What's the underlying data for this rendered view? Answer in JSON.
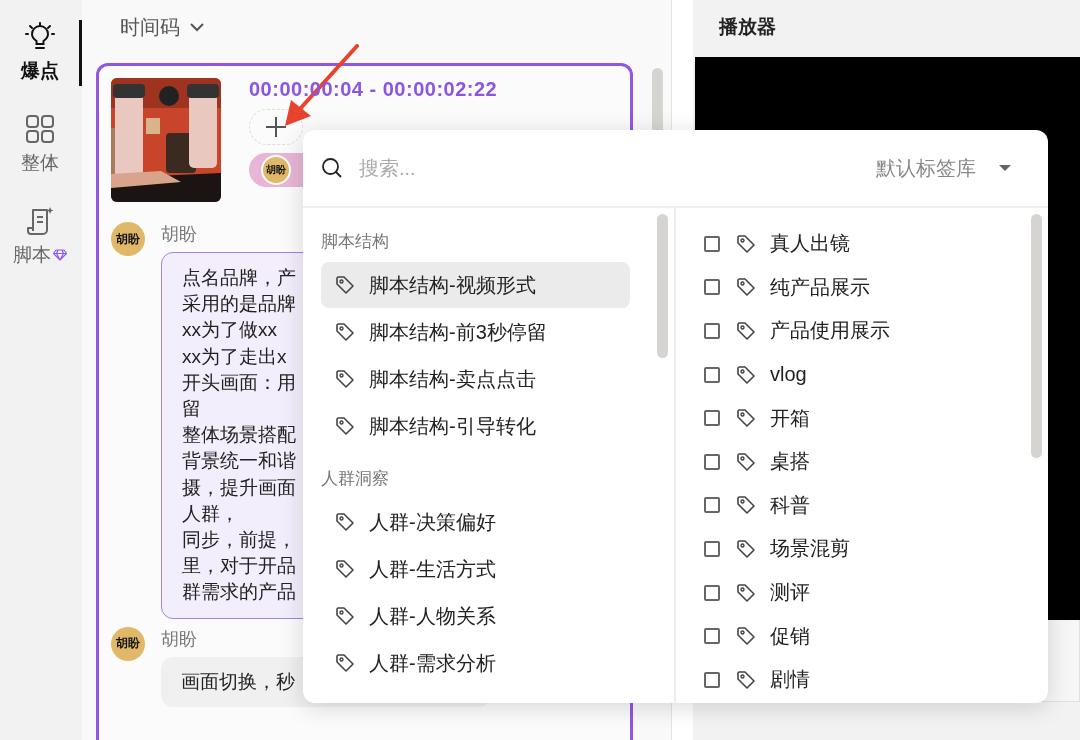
{
  "sidebar": {
    "items": [
      {
        "label": "爆点",
        "selected": true,
        "premium": false
      },
      {
        "label": "整体",
        "selected": false,
        "premium": false
      },
      {
        "label": "脚本",
        "selected": false,
        "premium": true
      }
    ]
  },
  "timeline": {
    "header": "时间码",
    "clip": {
      "timecode": "00:00:00:04 - 00:00:02:22",
      "tag_chip": {
        "avatar": "胡盼"
      },
      "comments": [
        {
          "avatar": "胡盼",
          "author": "胡盼",
          "highlighted": true,
          "lines": [
            "点名品牌，产",
            "采用的是品牌",
            "xx为了做xx",
            "xx为了走出x",
            "开头画面：用",
            "留",
            "整体场景搭配",
            "背景统一和谐",
            "摄，提升画面",
            "人群，",
            "同步，前提，",
            "里，对于开品",
            "群需求的产品"
          ]
        },
        {
          "avatar": "胡盼",
          "author": "胡盼",
          "highlighted": false,
          "lines": [
            "画面切换，秒"
          ]
        }
      ]
    }
  },
  "player": {
    "title": "播放器"
  },
  "tag_picker": {
    "search": {
      "placeholder": "搜索..."
    },
    "library": "默认标签库",
    "groups": [
      {
        "name": "脚本结构",
        "items": [
          {
            "label": "脚本结构-视频形式",
            "selected": true
          },
          {
            "label": "脚本结构-前3秒停留",
            "selected": false
          },
          {
            "label": "脚本结构-卖点点击",
            "selected": false
          },
          {
            "label": "脚本结构-引导转化",
            "selected": false
          }
        ]
      },
      {
        "name": "人群洞察",
        "items": [
          {
            "label": "人群-决策偏好",
            "selected": false
          },
          {
            "label": "人群-生活方式",
            "selected": false
          },
          {
            "label": "人群-人物关系",
            "selected": false
          },
          {
            "label": "人群-需求分析",
            "selected": false
          }
        ]
      }
    ],
    "tags": [
      {
        "label": "真人出镜",
        "checked": false
      },
      {
        "label": "纯产品展示",
        "checked": false
      },
      {
        "label": "产品使用展示",
        "checked": false
      },
      {
        "label": "vlog",
        "checked": false
      },
      {
        "label": "开箱",
        "checked": false
      },
      {
        "label": "桌搭",
        "checked": false
      },
      {
        "label": "科普",
        "checked": false
      },
      {
        "label": "场景混剪",
        "checked": false
      },
      {
        "label": "测评",
        "checked": false
      },
      {
        "label": "促销",
        "checked": false
      },
      {
        "label": "剧情",
        "checked": false
      }
    ]
  }
}
